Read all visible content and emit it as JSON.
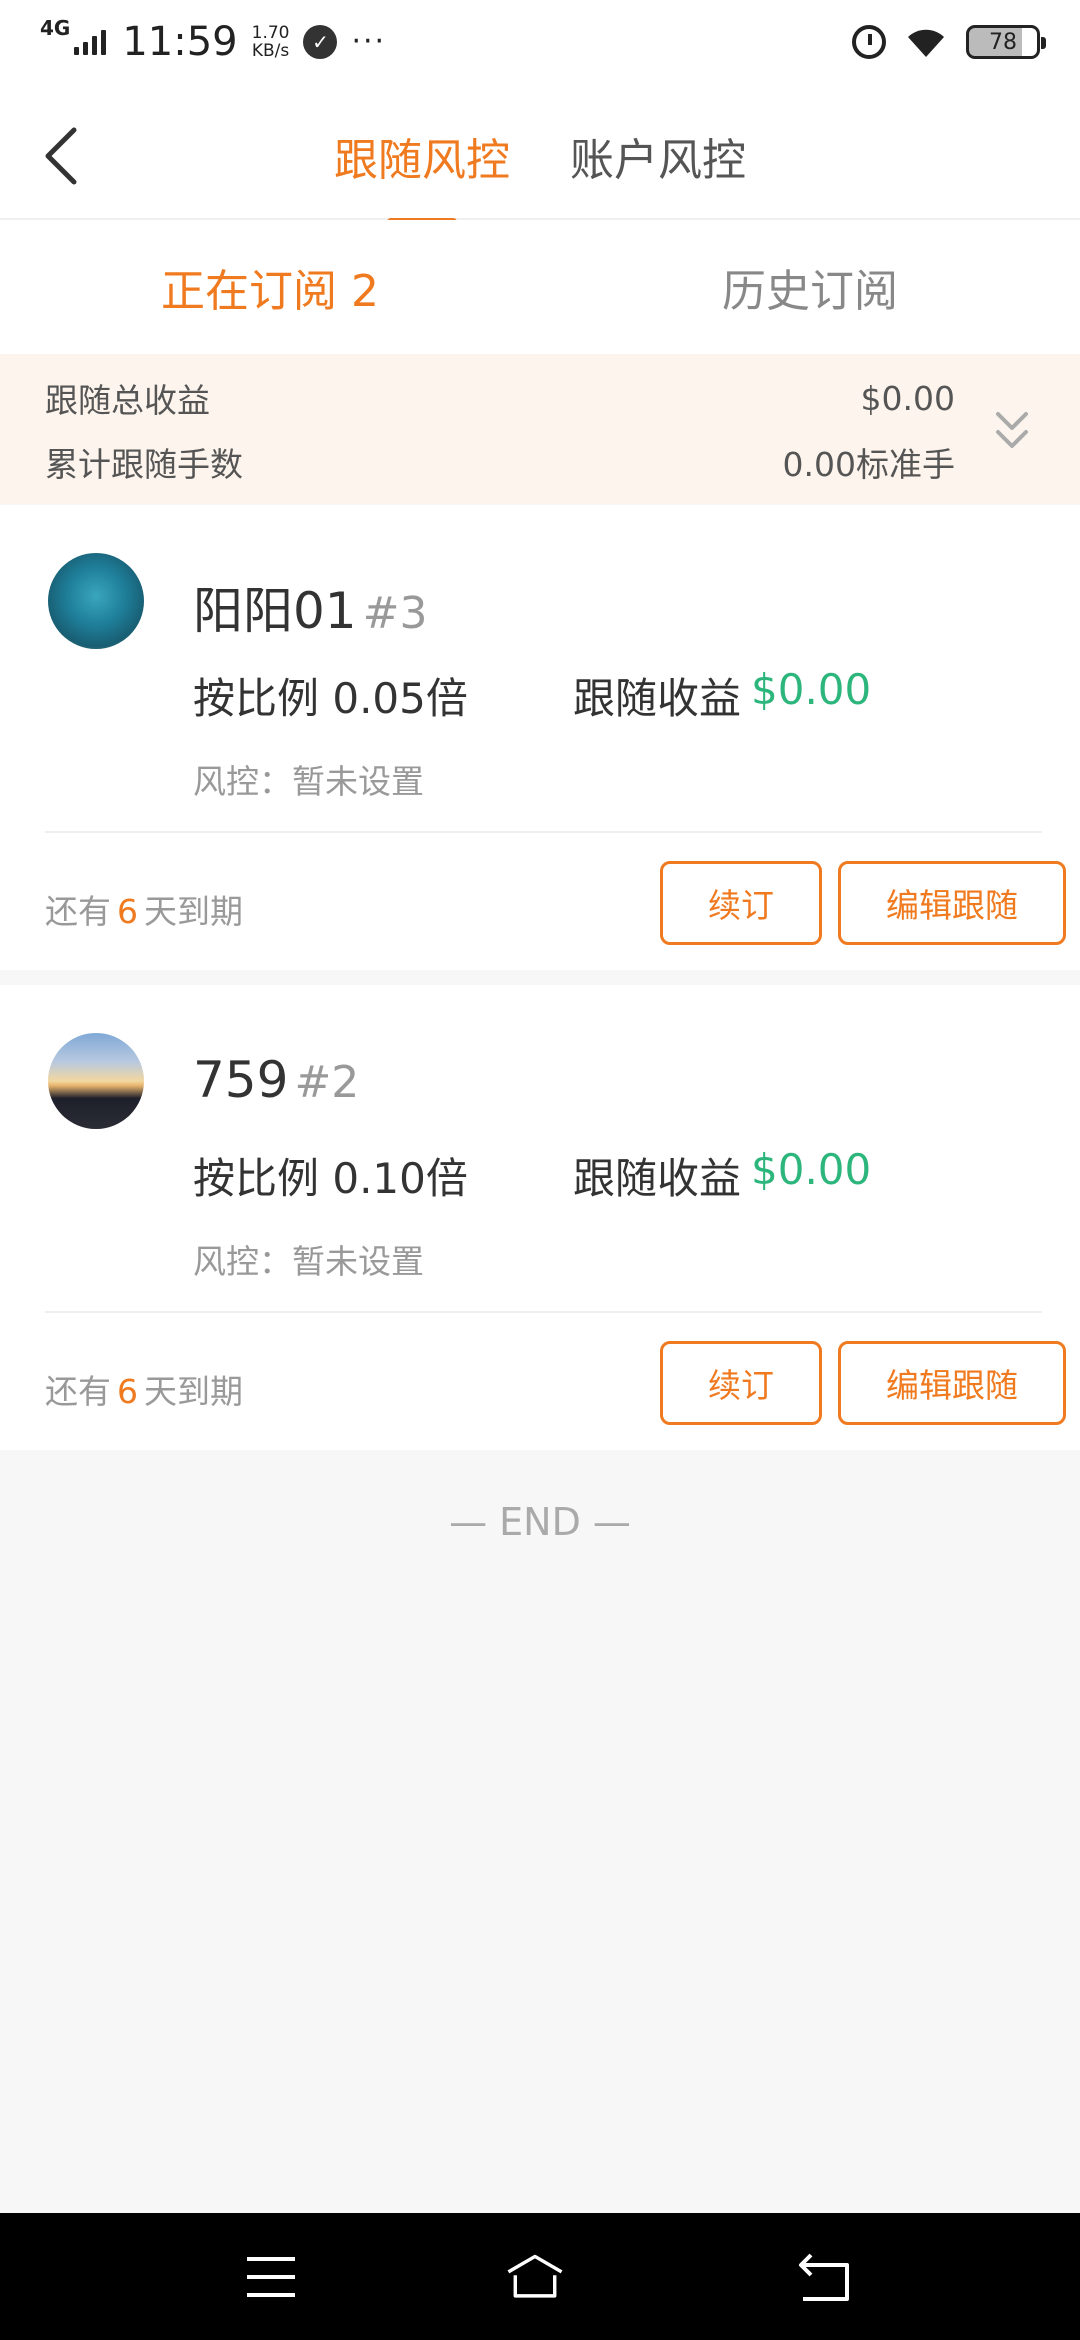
{
  "status_bar": {
    "network": "4G",
    "time": "11:59",
    "speed_value": "1.70",
    "speed_unit": "KB/s",
    "more": "···",
    "battery": "78"
  },
  "header": {
    "tabs": [
      {
        "label": "跟随风控",
        "active": true
      },
      {
        "label": "账户风控",
        "active": false
      }
    ]
  },
  "sub_tabs": [
    {
      "label": "正在订阅 2",
      "active": true
    },
    {
      "label": "历史订阅",
      "active": false
    }
  ],
  "summary": {
    "total_profit_label": "跟随总收益",
    "total_profit_value": "$0.00",
    "total_lots_label": "累计跟随手数",
    "total_lots_value": "0.00标准手"
  },
  "subscriptions": [
    {
      "name": "阳阳01",
      "rank": "#3",
      "ratio": "按比例 0.05倍",
      "profit_label": "跟随收益",
      "profit_value": "$0.00",
      "risk": "风控：暂未设置",
      "expire_prefix": "还有",
      "expire_days": "6",
      "expire_suffix": "天到期",
      "renew_label": "续订",
      "edit_label": "编辑跟随"
    },
    {
      "name": "759",
      "rank": "#2",
      "ratio": "按比例 0.10倍",
      "profit_label": "跟随收益",
      "profit_value": "$0.00",
      "risk": "风控：暂未设置",
      "expire_prefix": "还有",
      "expire_days": "6",
      "expire_suffix": "天到期",
      "renew_label": "续订",
      "edit_label": "编辑跟随"
    }
  ],
  "end_text": "— END —",
  "colors": {
    "accent": "#f07a1f",
    "profit": "#2db67c"
  }
}
